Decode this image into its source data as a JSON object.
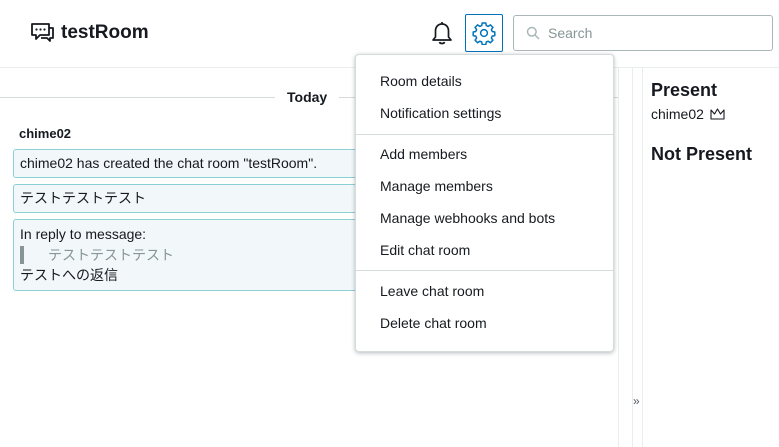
{
  "header": {
    "app_title": "testRoom",
    "search": {
      "placeholder": "Search",
      "value": ""
    },
    "accent_color": "#0073bb"
  },
  "chat": {
    "day_label": "Today",
    "sender": "chime02",
    "messages": [
      {
        "text": "chime02 has created the chat room \"testRoom\"."
      },
      {
        "text": "テストテストテスト"
      },
      {
        "reply_label": "In reply to message:",
        "quoted": "テストテストテスト",
        "text": "テストへの返信"
      }
    ],
    "collapse_glyph": "»"
  },
  "presence": {
    "present_heading": "Present",
    "present_members": [
      {
        "name": "chime02",
        "badge_icon": "crown-icon"
      }
    ],
    "not_present_heading": "Not Present"
  },
  "menu": {
    "groups": [
      [
        "Room details",
        "Notification settings"
      ],
      [
        "Add members",
        "Manage members",
        "Manage webhooks and bots",
        "Edit chat room"
      ],
      [
        "Leave chat room",
        "Delete chat room"
      ]
    ]
  }
}
